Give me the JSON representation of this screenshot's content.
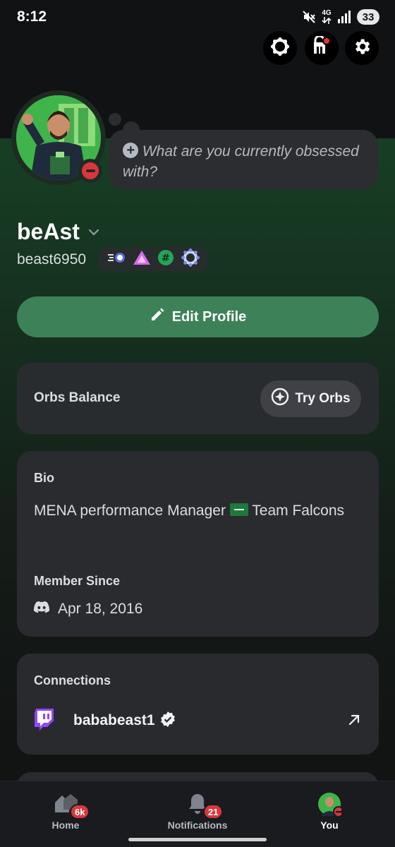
{
  "status_bar": {
    "time": "8:12",
    "network": "4G",
    "battery": "33",
    "icons": [
      "mute-icon",
      "network-4g-icon",
      "signal-icon",
      "battery-icon"
    ]
  },
  "top_actions": [
    {
      "name": "nitro-icon"
    },
    {
      "name": "shop-icon"
    },
    {
      "name": "settings-icon"
    }
  ],
  "profile": {
    "status_placeholder": "What are you currently obsessed with?",
    "display_name": "beAst",
    "username": "beast6950",
    "presence": "do-not-disturb",
    "badges": [
      "nitro-speed-badge",
      "hypesquad-badge",
      "server-tag-badge",
      "boost-badge"
    ],
    "edit_button": "Edit Profile"
  },
  "orbs": {
    "label": "Orbs Balance",
    "button": "Try Orbs"
  },
  "about": {
    "bio_label": "Bio",
    "bio_text_part1": "MENA performance Manager",
    "bio_text_part2": "Team Falcons",
    "member_since_label": "Member Since",
    "member_since_date": "Apr 18, 2016"
  },
  "connections": {
    "label": "Connections",
    "items": [
      {
        "service": "twitch",
        "name": "bababeast1",
        "verified": true
      }
    ]
  },
  "bottom_nav": {
    "items": [
      {
        "label": "Home",
        "badge": "6k",
        "active": false
      },
      {
        "label": "Notifications",
        "badge": "21",
        "active": false
      },
      {
        "label": "You",
        "badge": "",
        "active": true
      }
    ]
  },
  "colors": {
    "accent_green": "#3d8159",
    "dnd_red": "#da373c",
    "twitch_purple": "#9146ff",
    "card_bg": "#2b2d31"
  }
}
